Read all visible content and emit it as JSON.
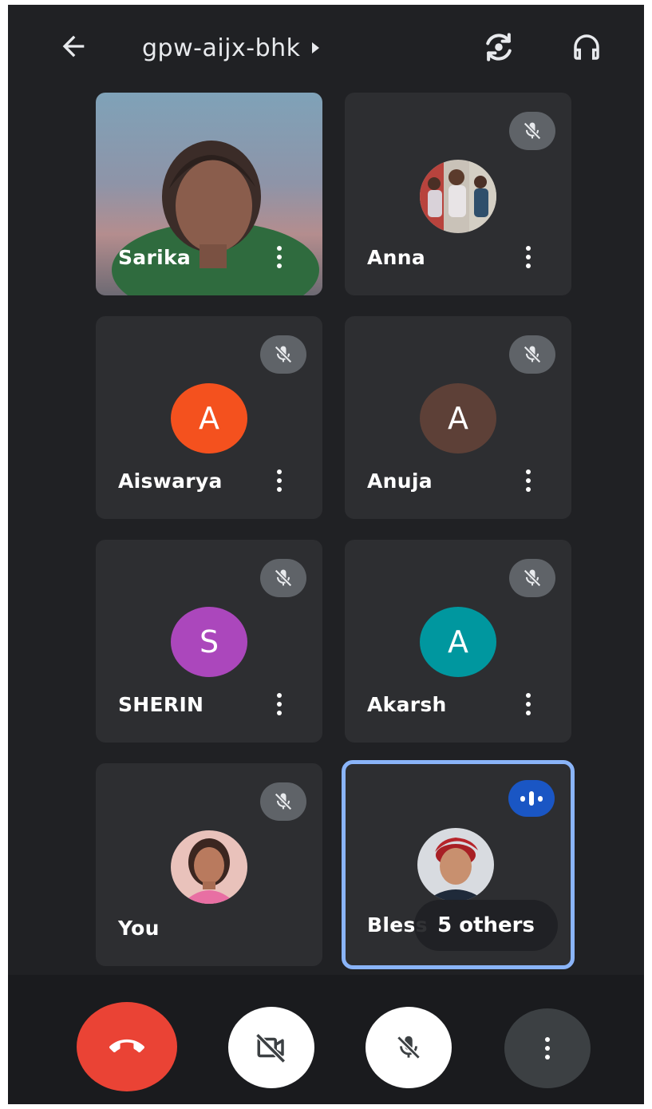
{
  "header": {
    "meeting_code": "gpw-aijx-bhk",
    "back_icon": "arrow-left-icon",
    "switch_camera_icon": "switch-camera-icon",
    "audio_output_icon": "headphones-icon"
  },
  "tiles": [
    {
      "name": "Sarika",
      "type": "video"
    },
    {
      "name": "Anna",
      "type": "photo",
      "muted": true
    },
    {
      "name": "Aiswarya",
      "type": "initial",
      "initial": "A",
      "color": "#f4511e",
      "muted": true
    },
    {
      "name": "Anuja",
      "type": "initial",
      "initial": "A",
      "color": "#5d4037",
      "muted": true
    },
    {
      "name": "SHERIN",
      "type": "initial",
      "initial": "S",
      "color": "#ab47bc",
      "muted": true
    },
    {
      "name": "Akarsh",
      "type": "initial",
      "initial": "A",
      "color": "#00979f",
      "muted": true
    },
    {
      "name": "You",
      "type": "photo",
      "muted": true
    },
    {
      "name": "Bless",
      "type": "photo",
      "speaking": true,
      "others_label": "5 others"
    }
  ],
  "controls": {
    "end_call_icon": "phone-hangup-icon",
    "camera_icon": "video-off-icon",
    "mic_icon": "mic-off-icon",
    "more_icon": "more-vert-icon"
  },
  "colors": {
    "background": "#202124",
    "tile": "#2d2e31",
    "end_call": "#ea4335",
    "speaking_border": "#8ab4f8",
    "speaking_badge": "#1a56c4"
  }
}
